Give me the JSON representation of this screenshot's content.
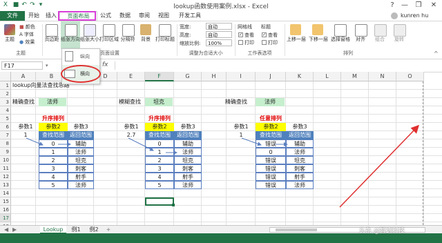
{
  "titlebar": {
    "title": "lookup函数使用案例.xlsx - Excel",
    "help": "?",
    "minimize": "—",
    "restore": "❐",
    "close": "✕"
  },
  "tabs": {
    "file": "文件",
    "home": "开始",
    "insert": "插入",
    "page_layout": "页面布局",
    "formulas": "公式",
    "data": "数据",
    "review": "审阅",
    "view": "视图",
    "developer": "开发工具"
  },
  "user": {
    "name": "kunren hu"
  },
  "ribbon": {
    "theme_group": {
      "themes": "主题",
      "colors": "颜色",
      "fonts": "字体",
      "effects": "效果",
      "label": "主题"
    },
    "page_setup": {
      "margins": "页边距",
      "orientation": "纸张方向",
      "size": "纸张大小",
      "print_area": "打印区域",
      "breaks": "分隔符",
      "background": "背景",
      "print_titles": "打印标题",
      "label": "页面设置"
    },
    "scale": {
      "width_label": "宽度:",
      "width_value": "自动",
      "height_label": "高度:",
      "height_value": "自动",
      "scale_label": "缩放比例:",
      "scale_value": "100%",
      "label": "调整为合适大小"
    },
    "sheet_options": {
      "gridlines": "网格线",
      "headings": "标题",
      "view1": "查看",
      "view2": "查看",
      "print1": "打印",
      "print2": "打印",
      "label": "工作表选项"
    },
    "arrange": {
      "bring_forward": "上移一层",
      "send_backward": "下移一层",
      "selection_pane": "选择窗格",
      "align": "对齐",
      "group": "组合",
      "rotate": "旋转",
      "label": "排列"
    }
  },
  "orientation_menu": {
    "portrait": "纵向",
    "landscape": "横向"
  },
  "formula_bar": {
    "name_box": "F17",
    "fx": "fx"
  },
  "columns": [
    "A",
    "B",
    "C",
    "D",
    "E",
    "F",
    "G",
    "H",
    "I",
    "J",
    "K",
    "L",
    "M",
    "N",
    "O"
  ],
  "rows": [
    "1",
    "2",
    "3",
    "4",
    "5",
    "6",
    "7",
    "8",
    "9",
    "10",
    "11",
    "12",
    "13",
    "14",
    "15",
    "16",
    "17",
    "18",
    "19"
  ],
  "sheet": {
    "title": "lookup向量法查找思路",
    "block1": {
      "lookup_label": "精确查找",
      "lookup_value": "法师",
      "sort_label": "升序排列",
      "p1": "参数1",
      "p2": "参数2",
      "p3": "参数3",
      "v1": "1",
      "h2": "查找范围",
      "h3": "返回范围",
      "col2": [
        "0",
        "1",
        "2",
        "3",
        "4",
        "5"
      ],
      "col3": [
        "辅助",
        "法师",
        "坦克",
        "刺客",
        "射手",
        "法师"
      ]
    },
    "block2": {
      "lookup_label": "模糊查找",
      "lookup_value": "坦克",
      "sort_label": "升序排列",
      "p1": "参数1",
      "p2": "参数2",
      "p3": "参数3",
      "v1": "2.7",
      "h2": "查找范围",
      "h3": "返回范围",
      "col2": [
        "0",
        "1",
        "2",
        "3",
        "4",
        "5"
      ],
      "col3": [
        "辅助",
        "法师",
        "坦克",
        "刺客",
        "射手",
        "法师"
      ]
    },
    "block3": {
      "lookup_label": "精确查找",
      "lookup_value": "法师",
      "sort_label": "任意排列",
      "p1": "参数1",
      "p2": "参数2",
      "p3": "参数3",
      "v1": "1",
      "h2": "查找范围",
      "h3": "返回范围",
      "col2": [
        "错误",
        "0",
        "错误",
        "错误",
        "错误",
        "错误"
      ],
      "col3": [
        "辅助",
        "法师",
        "坦克",
        "刺客",
        "射手",
        "法师"
      ]
    }
  },
  "sheet_tabs": {
    "active": "Lookup",
    "t2": "例1",
    "t3": "例2",
    "add": "+"
  },
  "watermark": "头条 @智选科技",
  "colors": {
    "excel_green": "#217346",
    "highlight_magenta": "#d83cd8",
    "circle_red": "#e03030",
    "header_blue": "#4f81bd",
    "cell_green": "#c6efce",
    "cell_yellow": "#ffff00"
  }
}
